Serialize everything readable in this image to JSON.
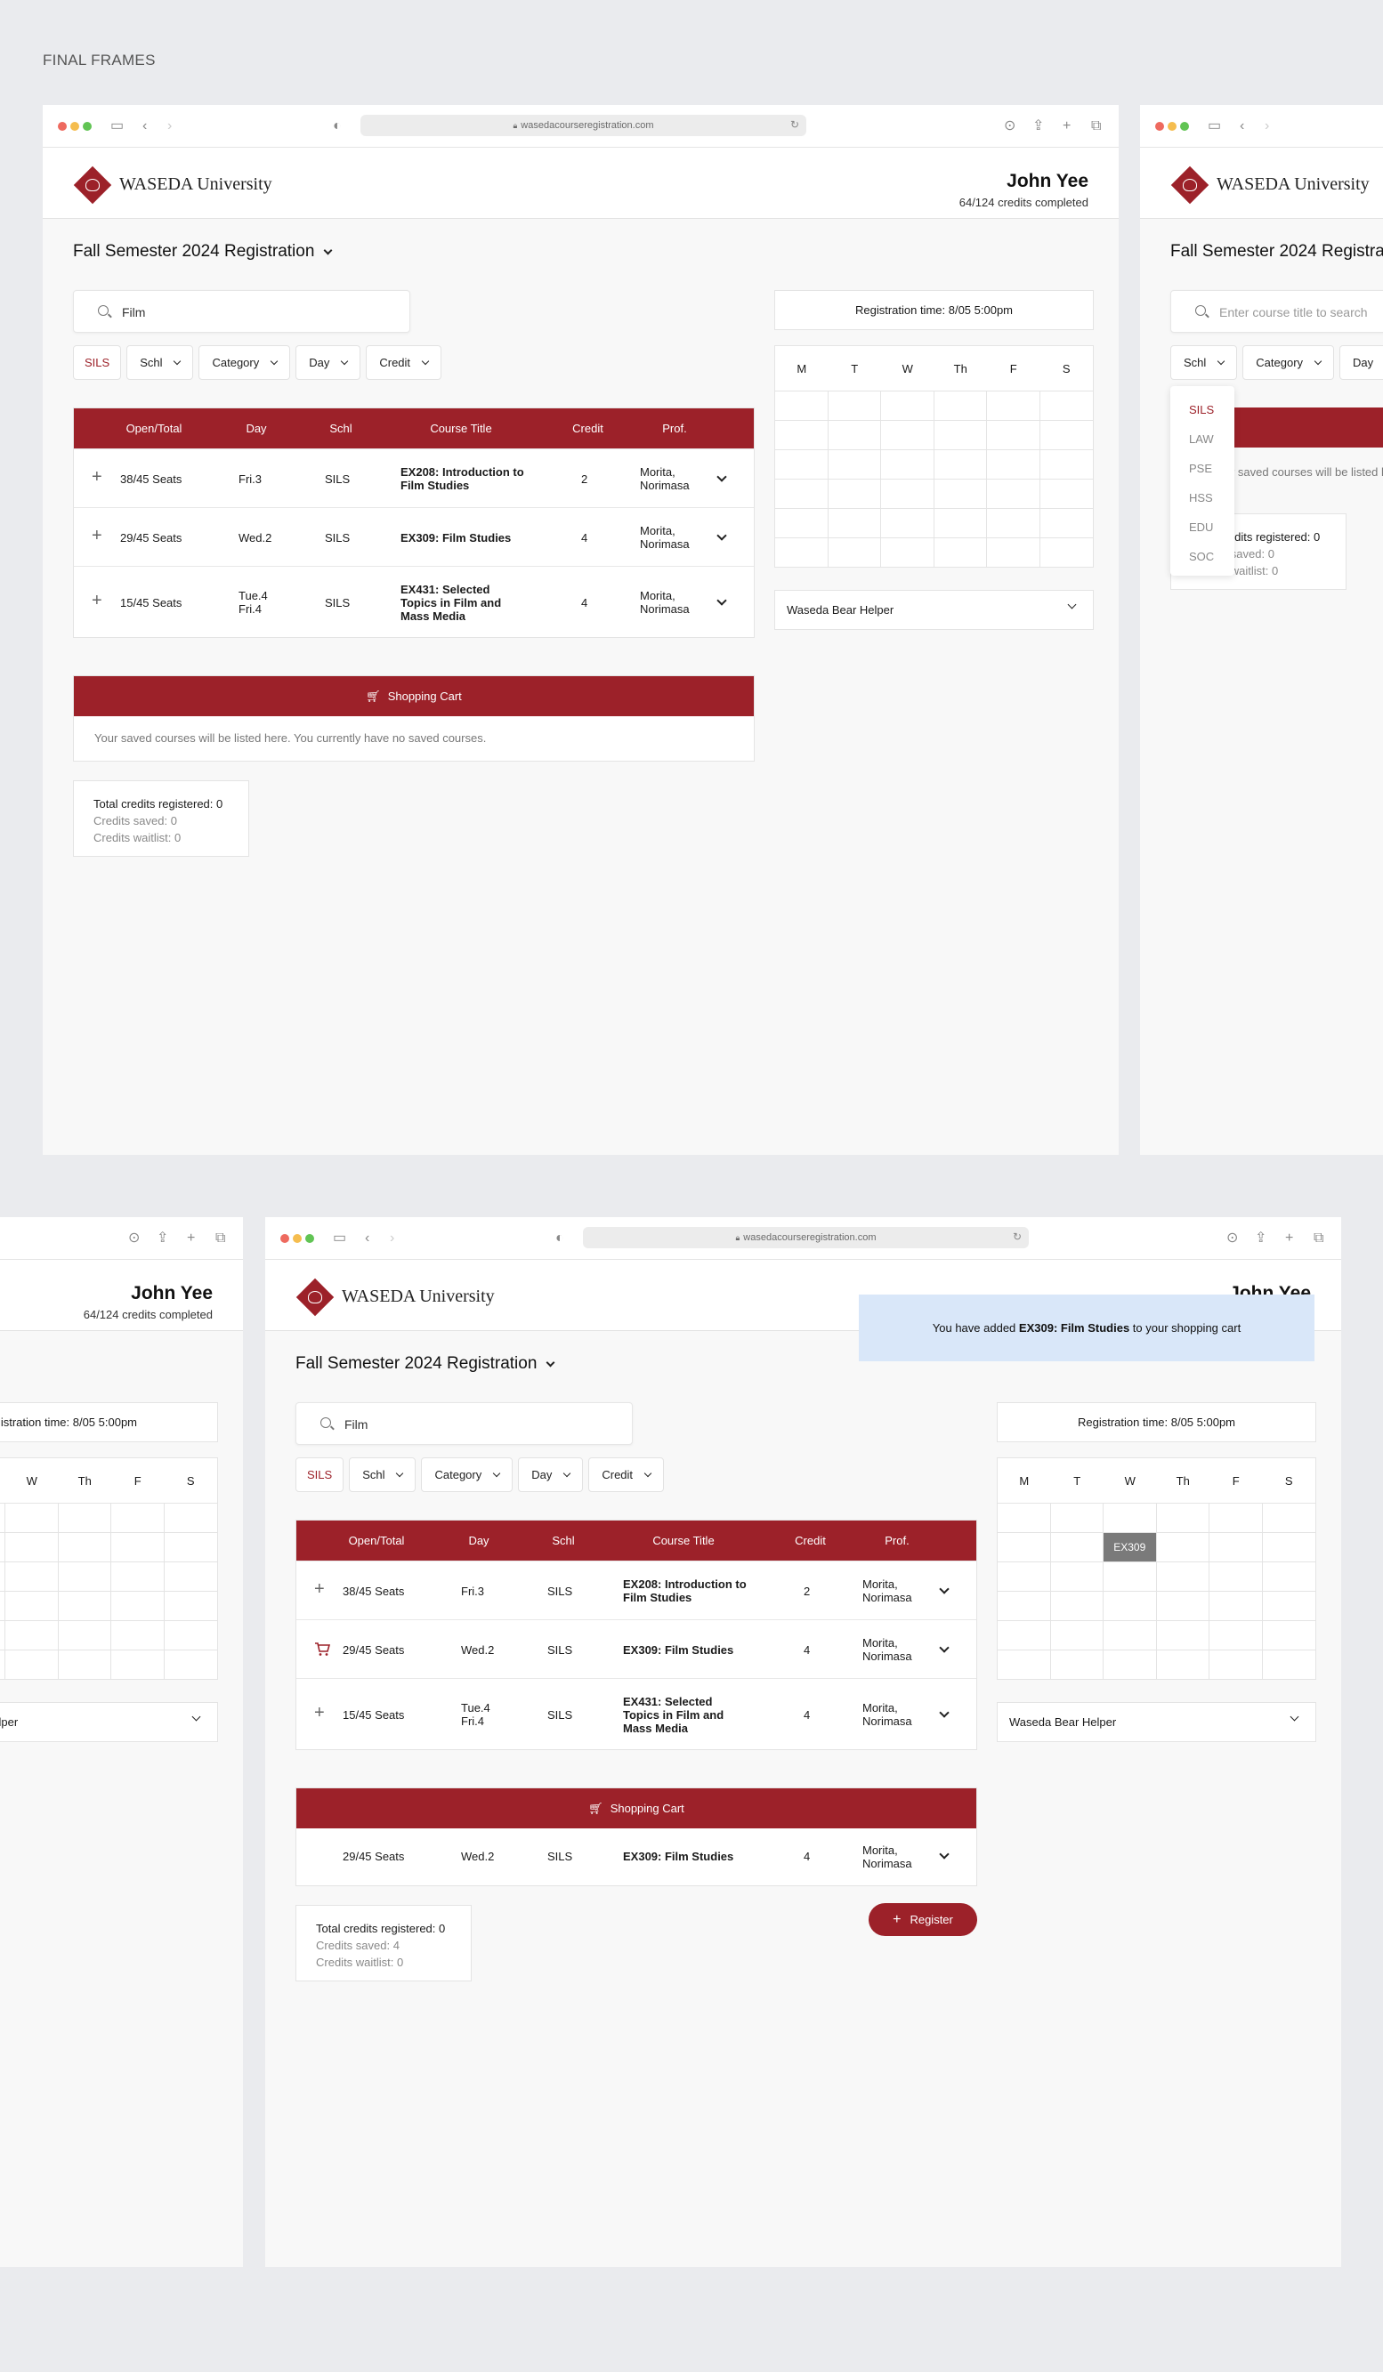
{
  "frames_title": "FINAL FRAMES",
  "browser": {
    "url": "wasedacourseregistration.com"
  },
  "header": {
    "uni_name": "WASEDA University",
    "user_name": "John Yee",
    "credits_completed": "64/124 credits completed"
  },
  "semester_title": "Fall Semester 2024 Registration",
  "search": {
    "value": "Film",
    "placeholder": "Enter course title to search"
  },
  "filters": {
    "selected": "SILS",
    "schl": "Schl",
    "category": "Category",
    "day": "Day",
    "credit": "Credit"
  },
  "table": {
    "headers": [
      "Open/Total",
      "Day",
      "Schl",
      "Course Title",
      "Credit",
      "Prof."
    ],
    "rows": [
      {
        "seats": "38/45 Seats",
        "day1": "Fri.3",
        "day2": "",
        "schl": "SILS",
        "title": "EX208: Introduction to Film Studies",
        "credit": "2",
        "prof": "Morita, Norimasa"
      },
      {
        "seats": "29/45 Seats",
        "day1": "Wed.2",
        "day2": "",
        "schl": "SILS",
        "title": "EX309: Film Studies",
        "credit": "4",
        "prof": "Morita, Norimasa"
      },
      {
        "seats": "15/45 Seats",
        "day1": "Tue.4",
        "day2": "Fri.4",
        "schl": "SILS",
        "title": "EX431: Selected Topics in Film and Mass Media",
        "credit": "4",
        "prof": "Morita, Norimasa"
      }
    ]
  },
  "cart": {
    "title": "Shopping Cart",
    "empty_text": "Your saved courses will be listed here. You currently have no saved courses.",
    "item": {
      "seats": "29/45 Seats",
      "day": "Wed.2",
      "schl": "SILS",
      "title": "EX309: Film Studies",
      "credit": "4",
      "prof": "Morita, Norimasa"
    }
  },
  "credits_box1": {
    "total": "Total credits registered: 0",
    "saved": "Credits saved: 0",
    "waitlist": "Credits waitlist: 0"
  },
  "credits_box2": {
    "total": "Total credits registered: 0",
    "saved": "Credits saved: 4",
    "waitlist": "Credits waitlist: 0"
  },
  "registration_time": "Registration time: 8/05 5:00pm",
  "calendar": {
    "days": [
      "M",
      "T",
      "W",
      "Th",
      "F",
      "S"
    ],
    "block_label": "EX309"
  },
  "helper": "Waseda Bear Helper",
  "toast": {
    "prefix": "You have added ",
    "course": "EX309: Film Studies",
    "suffix": " to your shopping cart"
  },
  "register_button": "Register",
  "schl_dropdown": [
    "SILS",
    "LAW",
    "PSE",
    "HSS",
    "EDU",
    "SOC"
  ]
}
